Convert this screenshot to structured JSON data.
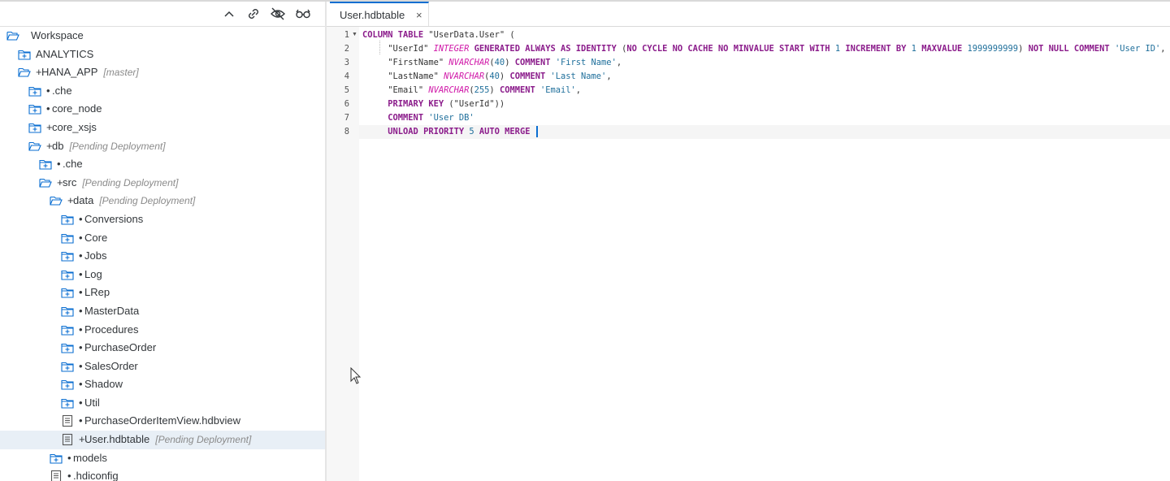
{
  "toolbar": {
    "icons": [
      "collapse-all-icon",
      "link-with-editor-icon",
      "hide-hidden-files-icon",
      "glasses-icon"
    ]
  },
  "tree": [
    {
      "label": "Workspace",
      "mark": "",
      "status": "",
      "icon": "folder-open",
      "level": 0
    },
    {
      "label": "ANALYTICS",
      "mark": "",
      "status": "",
      "icon": "folder-plus",
      "level": 1
    },
    {
      "label": "HANA_APP",
      "mark": "+",
      "status": "[master]",
      "icon": "folder-open",
      "level": 1
    },
    {
      "label": ".che",
      "mark": "•",
      "status": "",
      "icon": "folder-plus",
      "level": 2
    },
    {
      "label": "core_node",
      "mark": "•",
      "status": "",
      "icon": "folder-plus",
      "level": 2
    },
    {
      "label": "core_xsjs",
      "mark": "+",
      "status": "",
      "icon": "folder-plus",
      "level": 2
    },
    {
      "label": "db",
      "mark": "+",
      "status": "[Pending Deployment]",
      "icon": "folder-open",
      "level": 2
    },
    {
      "label": ".che",
      "mark": "•",
      "status": "",
      "icon": "folder-plus",
      "level": 3
    },
    {
      "label": "src",
      "mark": "+",
      "status": "[Pending Deployment]",
      "icon": "folder-open",
      "level": 3
    },
    {
      "label": "data",
      "mark": "+",
      "status": "[Pending Deployment]",
      "icon": "folder-open",
      "level": 4
    },
    {
      "label": "Conversions",
      "mark": "•",
      "status": "",
      "icon": "folder-plus",
      "level": 5
    },
    {
      "label": "Core",
      "mark": "•",
      "status": "",
      "icon": "folder-plus",
      "level": 5
    },
    {
      "label": "Jobs",
      "mark": "•",
      "status": "",
      "icon": "folder-plus",
      "level": 5
    },
    {
      "label": "Log",
      "mark": "•",
      "status": "",
      "icon": "folder-plus",
      "level": 5
    },
    {
      "label": "LRep",
      "mark": "•",
      "status": "",
      "icon": "folder-plus",
      "level": 5
    },
    {
      "label": "MasterData",
      "mark": "•",
      "status": "",
      "icon": "folder-plus",
      "level": 5
    },
    {
      "label": "Procedures",
      "mark": "•",
      "status": "",
      "icon": "folder-plus",
      "level": 5
    },
    {
      "label": "PurchaseOrder",
      "mark": "•",
      "status": "",
      "icon": "folder-plus",
      "level": 5
    },
    {
      "label": "SalesOrder",
      "mark": "•",
      "status": "",
      "icon": "folder-plus",
      "level": 5
    },
    {
      "label": "Shadow",
      "mark": "•",
      "status": "",
      "icon": "folder-plus",
      "level": 5
    },
    {
      "label": "Util",
      "mark": "•",
      "status": "",
      "icon": "folder-plus",
      "level": 5
    },
    {
      "label": "PurchaseOrderItemView.hdbview",
      "mark": "•",
      "status": "",
      "icon": "file",
      "level": 5
    },
    {
      "label": "User.hdbtable",
      "mark": "+",
      "status": "[Pending Deployment]",
      "icon": "file",
      "level": 5,
      "selected": true
    },
    {
      "label": "models",
      "mark": "•",
      "status": "",
      "icon": "folder-plus",
      "level": 4
    },
    {
      "label": ".hdiconfig",
      "mark": "•",
      "status": "",
      "icon": "file",
      "level": 4
    }
  ],
  "editor": {
    "tab": {
      "label": "User.hdbtable",
      "close": "×"
    },
    "lines": [
      {
        "n": "1",
        "tokens": [
          [
            "kw",
            "COLUMN TABLE "
          ],
          [
            "",
            "\"UserData.User\" ("
          ]
        ]
      },
      {
        "n": "2",
        "tokens": [
          [
            "",
            "     \"UserId\" "
          ],
          [
            "ty",
            "INTEGER"
          ],
          [
            "kw",
            " GENERATED ALWAYS AS IDENTITY "
          ],
          [
            "",
            "("
          ],
          [
            "kw",
            "NO CYCLE NO CACHE NO MINVALUE START WITH "
          ],
          [
            "nm",
            "1"
          ],
          [
            "kw",
            " INCREMENT BY "
          ],
          [
            "nm",
            "1"
          ],
          [
            "kw",
            " MAXVALUE "
          ],
          [
            "nm",
            "1999999999"
          ],
          [
            "",
            ") "
          ],
          [
            "kw",
            "NOT NULL COMMENT "
          ],
          [
            "st",
            "'User ID'"
          ],
          [
            "",
            ","
          ]
        ]
      },
      {
        "n": "3",
        "tokens": [
          [
            "",
            "     \"FirstName\" "
          ],
          [
            "ty",
            "NVARCHAR"
          ],
          [
            "",
            "("
          ],
          [
            "nm",
            "40"
          ],
          [
            "",
            ") "
          ],
          [
            "kw",
            "COMMENT "
          ],
          [
            "st",
            "'First Name'"
          ],
          [
            "",
            ","
          ]
        ]
      },
      {
        "n": "4",
        "tokens": [
          [
            "",
            "     \"LastName\" "
          ],
          [
            "ty",
            "NVARCHAR"
          ],
          [
            "",
            "("
          ],
          [
            "nm",
            "40"
          ],
          [
            "",
            ") "
          ],
          [
            "kw",
            "COMMENT "
          ],
          [
            "st",
            "'Last Name'"
          ],
          [
            "",
            ","
          ]
        ]
      },
      {
        "n": "5",
        "tokens": [
          [
            "",
            "     \"Email\" "
          ],
          [
            "ty",
            "NVARCHAR"
          ],
          [
            "",
            "("
          ],
          [
            "nm",
            "255"
          ],
          [
            "",
            ") "
          ],
          [
            "kw",
            "COMMENT "
          ],
          [
            "st",
            "'Email'"
          ],
          [
            "",
            ","
          ]
        ]
      },
      {
        "n": "6",
        "tokens": [
          [
            "",
            "     "
          ],
          [
            "kw",
            "PRIMARY KEY "
          ],
          [
            "",
            "(\"UserId\"))"
          ]
        ]
      },
      {
        "n": "7",
        "tokens": [
          [
            "",
            "     "
          ],
          [
            "kw",
            "COMMENT "
          ],
          [
            "st",
            "'User DB'"
          ]
        ]
      },
      {
        "n": "8",
        "tokens": [
          [
            "",
            "     "
          ],
          [
            "kw",
            "UNLOAD PRIORITY "
          ],
          [
            "nm",
            "5"
          ],
          [
            "kw",
            " AUTO MERGE "
          ]
        ],
        "active": true
      }
    ]
  }
}
